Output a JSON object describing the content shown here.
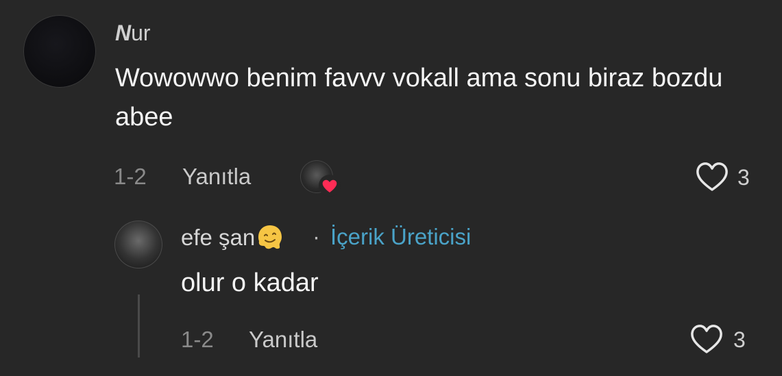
{
  "comment": {
    "username_first": "N",
    "username_rest": "ur",
    "text": "Wowowwo benim favvv vokall ama sonu biraz bozdu abee",
    "date": "1-2",
    "reply_label": "Yanıtla",
    "like_count": "3",
    "liked_by_creator": true
  },
  "reply": {
    "username": "efe şan",
    "emoji": "melting-face-emoji",
    "separator": "·",
    "creator_label": "İçerik Üreticisi",
    "text": "olur o kadar",
    "date": "1-2",
    "reply_label": "Yanıtla",
    "like_count": "3"
  },
  "colors": {
    "background": "#272727",
    "creator_tag": "#4aa3c8",
    "heart": "#fe2c55"
  }
}
